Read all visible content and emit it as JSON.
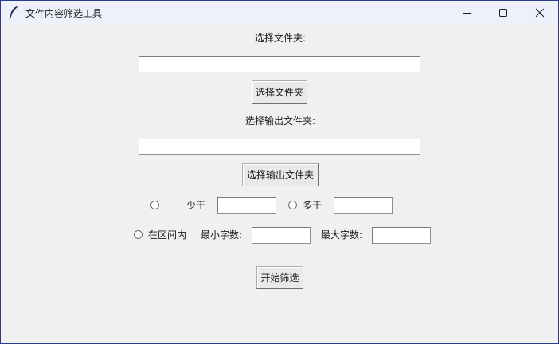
{
  "window": {
    "title": "文件内容筛选工具",
    "icon": "feather-icon",
    "controls": [
      "minimize-icon",
      "maximize-icon",
      "close-icon"
    ]
  },
  "form": {
    "folder_label": "选择文件夹:",
    "folder_value": "",
    "folder_button": "选择文件夹",
    "output_label": "选择输出文件夹:",
    "output_value": "",
    "output_button": "选择输出文件夹",
    "less_than_label": "少于",
    "less_than_value": "",
    "more_than_label": "多于",
    "more_than_value": "",
    "range_label": "在区间内",
    "min_label": "最小字数:",
    "min_value": "",
    "max_label": "最大字数:",
    "max_value": "",
    "start_button": "开始筛选"
  },
  "colors": {
    "window_border": "#2b3a8c",
    "titlebar": "#eef1f9",
    "body": "#f0f0f0"
  }
}
